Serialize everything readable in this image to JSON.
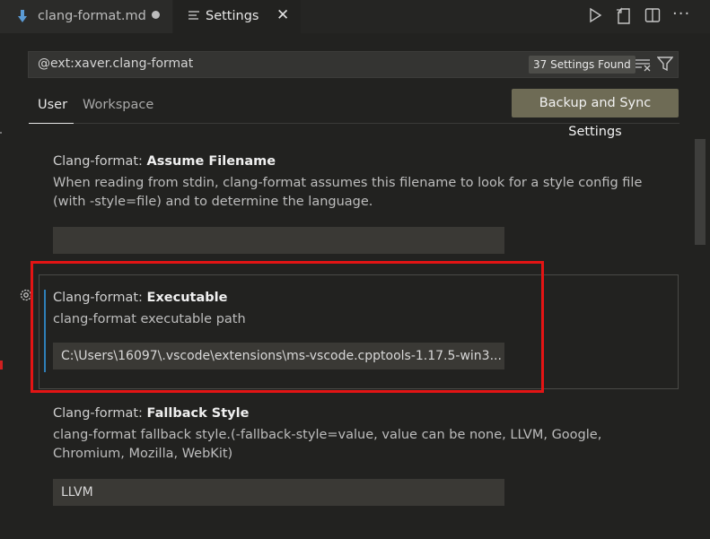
{
  "tabs": [
    {
      "label": "clang-format.md",
      "icon": "markdown-file-icon",
      "dirty": true
    },
    {
      "label": "Settings",
      "icon": "settings-editor-icon",
      "active": true
    }
  ],
  "editor_actions": [
    "run-icon",
    "open-json-icon",
    "split-editor-icon",
    "more-actions-icon"
  ],
  "search": {
    "value": "@ext:xaver.clang-format",
    "results_badge": "37 Settings Found"
  },
  "scopes": [
    {
      "label": "User",
      "active": true
    },
    {
      "label": "Workspace"
    }
  ],
  "sync_button": "Backup and Sync Settings",
  "settings": [
    {
      "category": "Clang-format: ",
      "name": "Assume Filename",
      "description": "When reading from stdin, clang-format assumes this filename to look for a style config file (with -style=file) and to determine the language.",
      "value": ""
    },
    {
      "category": "Clang-format: ",
      "name": "Executable",
      "description": "clang-format executable path",
      "value": "C:\\Users\\16097\\.vscode\\extensions\\ms-vscode.cpptools-1.17.5-win3..."
    },
    {
      "category": "Clang-format: ",
      "name": "Fallback Style",
      "description": "clang-format fallback style.(-fallback-style=value, value can be none, LLVM, Google, Chromium, Mozilla, WebKit)",
      "value": "LLVM"
    }
  ],
  "colors": {
    "highlight": "#e31414",
    "focus_accent": "#2e7fb8",
    "sync_button_bg": "#6e6b55"
  }
}
